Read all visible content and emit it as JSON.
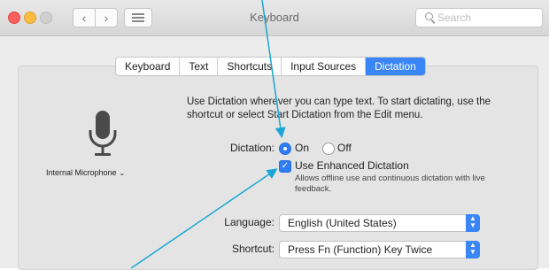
{
  "window": {
    "title": "Keyboard",
    "search_placeholder": "Search",
    "nav_back": "‹",
    "nav_forward": "›"
  },
  "tabs": [
    {
      "label": "Keyboard",
      "active": false
    },
    {
      "label": "Text",
      "active": false
    },
    {
      "label": "Shortcuts",
      "active": false
    },
    {
      "label": "Input Sources",
      "active": false
    },
    {
      "label": "Dictation",
      "active": true
    }
  ],
  "microphone": {
    "label": "Internal Microphone",
    "chevron": "⌄"
  },
  "dictation": {
    "description": "Use Dictation wherever you can type text. To start dictating, use the shortcut or select Start Dictation from the Edit menu.",
    "label": "Dictation:",
    "on_label": "On",
    "off_label": "Off",
    "selected": "On",
    "enhanced_label": "Use Enhanced Dictation",
    "enhanced_checked": true,
    "enhanced_note": "Allows offline use and continuous dictation with live feedback."
  },
  "language": {
    "label": "Language:",
    "value": "English (United States)"
  },
  "shortcut": {
    "label": "Shortcut:",
    "value": "Press Fn (Function) Key Twice"
  },
  "colors": {
    "accent": "#3a86f6",
    "annotation_arrow": "#1aa7d6"
  }
}
